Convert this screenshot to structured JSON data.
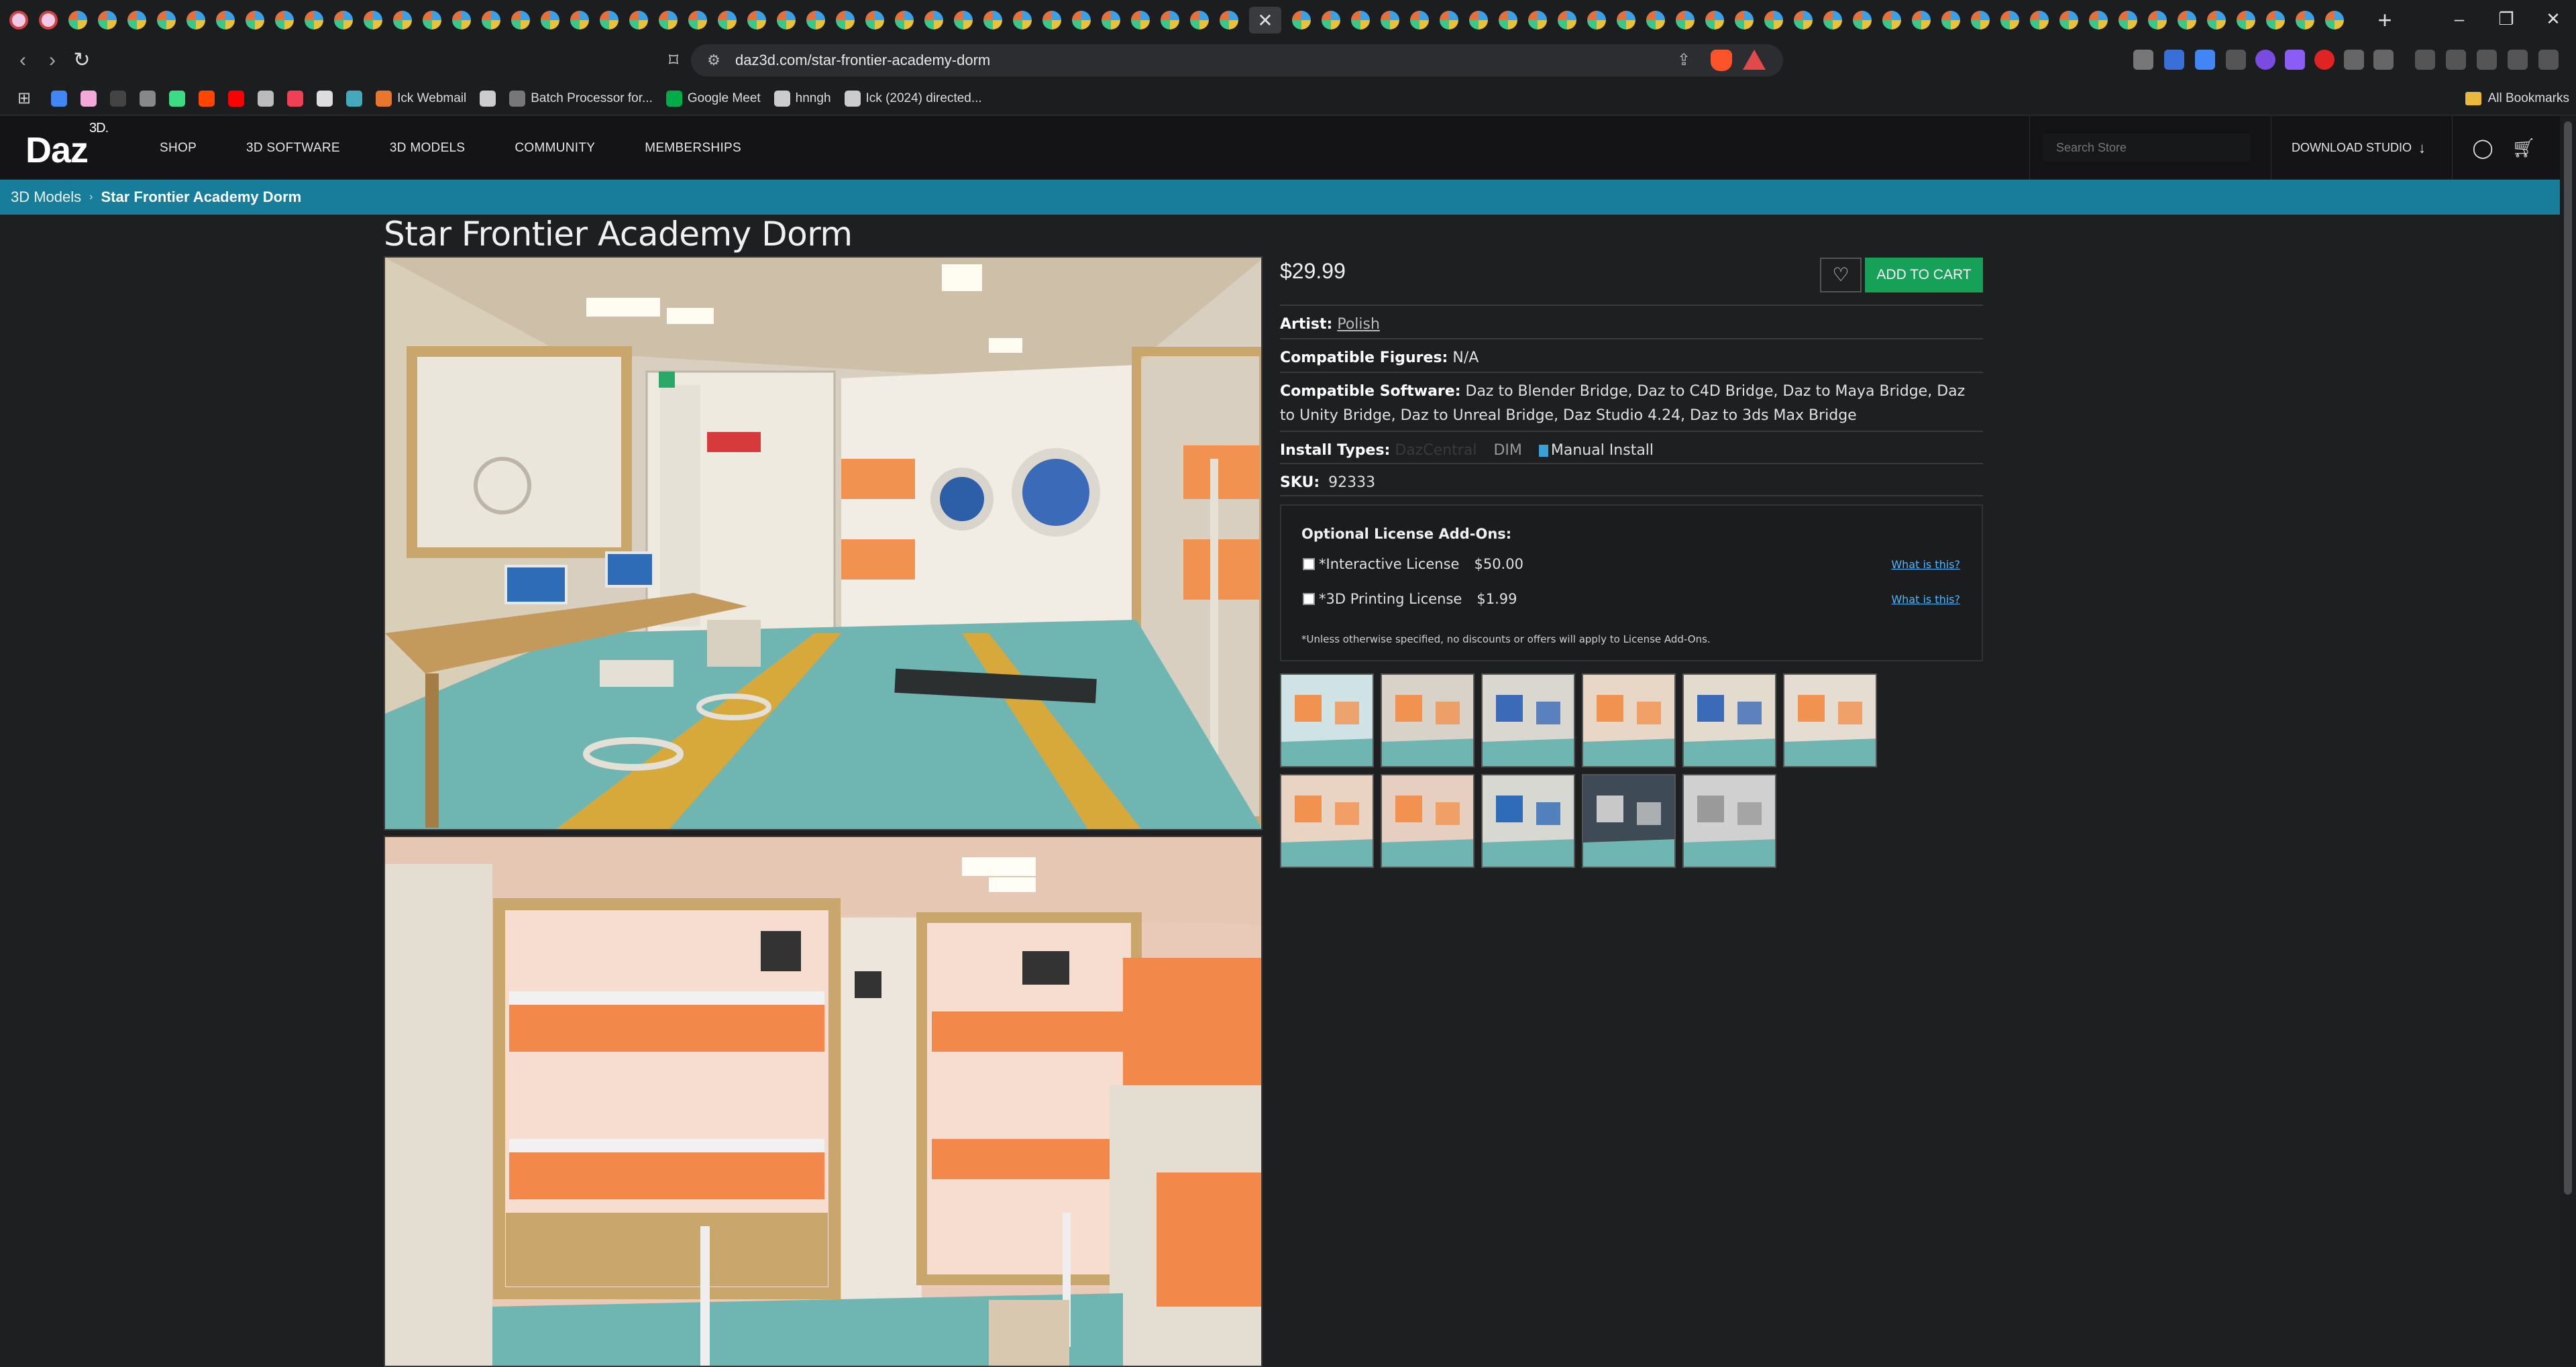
{
  "browser": {
    "url": "daz3d.com/star-frontier-academy-dorm",
    "bookmarks": [
      {
        "label": "",
        "icon": "google-icon",
        "color": "#4285f4"
      },
      {
        "label": "",
        "icon": "ghost-icon",
        "color": "#f2a8d8"
      },
      {
        "label": "",
        "icon": "circle-icon",
        "color": "#444"
      },
      {
        "label": "",
        "icon": "chat-icon",
        "color": "#888"
      },
      {
        "label": "",
        "icon": "android-icon",
        "color": "#3ddc84"
      },
      {
        "label": "",
        "icon": "reddit-icon",
        "color": "#ff4500"
      },
      {
        "label": "",
        "icon": "youtube-icon",
        "color": "#ff0000"
      },
      {
        "label": "",
        "icon": "car-icon",
        "color": "#bbb"
      },
      {
        "label": "",
        "icon": "pocket-icon",
        "color": "#ef4056"
      },
      {
        "label": "",
        "icon": "at-icon",
        "color": "#ddd"
      },
      {
        "label": "",
        "icon": "extension-icon",
        "color": "#4ab"
      },
      {
        "label": "Ick Webmail",
        "icon": "webmail-icon",
        "color": "#e8762c"
      },
      {
        "label": "",
        "icon": "globe-icon",
        "color": "#ccc"
      },
      {
        "label": "Batch Processor for...",
        "icon": "batch-icon",
        "color": "#777"
      },
      {
        "label": "Google Meet",
        "icon": "meet-icon",
        "color": "#00ac47"
      },
      {
        "label": "hnngh",
        "icon": "globe-icon",
        "color": "#ccc"
      },
      {
        "label": "Ick (2024) directed...",
        "icon": "globe-icon",
        "color": "#ccc"
      }
    ],
    "all_bookmarks_label": "All Bookmarks"
  },
  "header": {
    "logo_text": "Daz",
    "logo_sup": "3D.",
    "nav": [
      "SHOP",
      "3D SOFTWARE",
      "3D MODELS",
      "COMMUNITY",
      "MEMBERSHIPS"
    ],
    "search_placeholder": "Search Store",
    "download_label": "DOWNLOAD STUDIO"
  },
  "breadcrumb": {
    "parent": "3D Models",
    "current": "Star Frontier Academy Dorm"
  },
  "product": {
    "title": "Star Frontier Academy Dorm",
    "price": "$29.99",
    "add_to_cart": "ADD TO CART",
    "artist_label": "Artist:",
    "artist": "Polish",
    "figures_label": "Compatible Figures:",
    "figures": "N/A",
    "software_label": "Compatible Software:",
    "software": "Daz to Blender Bridge, Daz to C4D Bridge, Daz to Maya Bridge, Daz to Unity Bridge, Daz to Unreal Bridge, Daz Studio 4.24, Daz to 3ds Max Bridge",
    "install_label": "Install Types:",
    "install_dazcentral": "DazCentral",
    "install_dim": "DIM",
    "install_manual": "Manual Install",
    "sku_label": "SKU:",
    "sku": "92333"
  },
  "license": {
    "heading": "Optional License Add-Ons:",
    "items": [
      {
        "label": "*Interactive License",
        "price": "$50.00",
        "link": "What is this?"
      },
      {
        "label": "*3D Printing License",
        "price": "$1.99",
        "link": "What is this?"
      }
    ],
    "note": "*Unless otherwise specified, no discounts or offers will apply to License Add-Ons."
  },
  "colors": {
    "accent_teal": "#177d9b",
    "cart_green": "#17a058",
    "bg": "#1e1f21"
  }
}
